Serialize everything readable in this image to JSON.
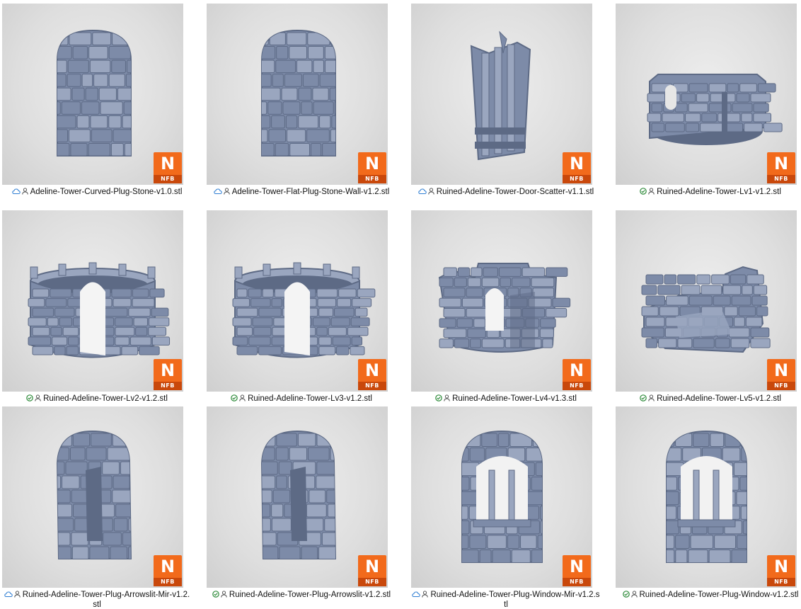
{
  "files": [
    {
      "name": "Adeline-Tower-Curved-Plug-Stone-v1.0.stl",
      "status": "cloud",
      "model": "arch-wall"
    },
    {
      "name": "Adeline-Tower-Flat-Plug-Stone-Wall-v1.2.stl",
      "status": "cloud",
      "model": "arch-wall"
    },
    {
      "name": "Ruined-Adeline-Tower-Door-Scatter-v1.1.stl",
      "status": "cloud",
      "model": "door"
    },
    {
      "name": "Ruined-Adeline-Tower-Lv1-v1.2.stl",
      "status": "synced",
      "model": "ruin-low"
    },
    {
      "name": "Ruined-Adeline-Tower-Lv2-v1.2.stl",
      "status": "synced",
      "model": "tower-ring"
    },
    {
      "name": "Ruined-Adeline-Tower-Lv3-v1.2.stl",
      "status": "synced",
      "model": "tower-ring"
    },
    {
      "name": "Ruined-Adeline-Tower-Lv4-v1.3.stl",
      "status": "synced",
      "model": "tower-ruin"
    },
    {
      "name": "Ruined-Adeline-Tower-Lv5-v1.2.stl",
      "status": "synced",
      "model": "ruin-top"
    },
    {
      "name": "Ruined-Adeline-Tower-Plug-Arrowslit-Mir-v1.2.stl",
      "status": "cloud",
      "model": "arrowslit"
    },
    {
      "name": "Ruined-Adeline-Tower-Plug-Arrowslit-v1.2.stl",
      "status": "synced",
      "model": "arrowslit"
    },
    {
      "name": "Ruined-Adeline-Tower-Plug-Window-Mir-v1.2.stl",
      "status": "cloud",
      "model": "window"
    },
    {
      "name": "Ruined-Adeline-Tower-Plug-Window-v1.2.stl",
      "status": "synced",
      "model": "window"
    }
  ],
  "badge": {
    "letter": "N",
    "label": "NFB",
    "color": "#f26a1b",
    "dark": "#c9480b"
  },
  "icons": {
    "cloud": "cloud-icon",
    "synced": "check-circle-icon",
    "person": "person-icon"
  },
  "colors": {
    "model": "#7d8ba8",
    "model_dark": "#5d6a85",
    "model_light": "#9aa6bf",
    "synced": "#2e8b3a",
    "cloud": "#2d7dd2"
  }
}
